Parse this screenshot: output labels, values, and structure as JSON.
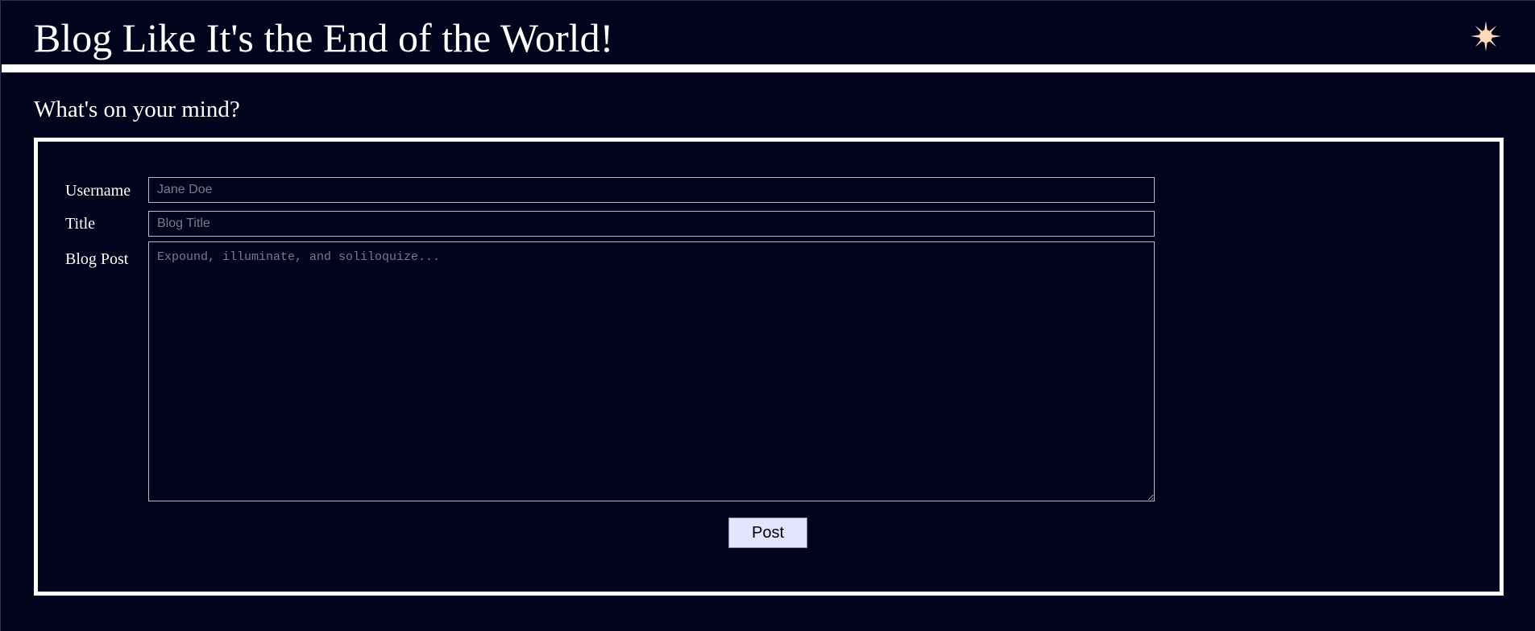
{
  "header": {
    "title": "Blog Like It's the End of the World!",
    "theme_toggle_icon": "sun-icon",
    "sun_color": "#ffd9b8"
  },
  "main": {
    "prompt": "What's on your mind?"
  },
  "form": {
    "username": {
      "label": "Username",
      "placeholder": "Jane Doe",
      "value": ""
    },
    "title": {
      "label": "Title",
      "placeholder": "Blog Title",
      "value": ""
    },
    "post": {
      "label": "Blog Post",
      "placeholder": "Expound, illuminate, and soliloquize...",
      "value": ""
    },
    "submit_label": "Post"
  },
  "colors": {
    "background": "#02031c",
    "foreground": "#ffffff",
    "button_background": "#e4e4ff"
  }
}
